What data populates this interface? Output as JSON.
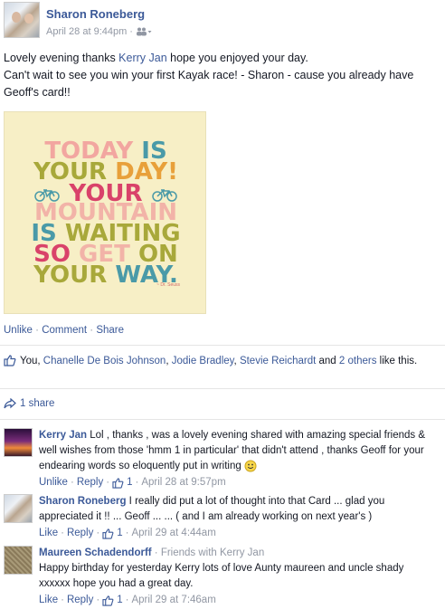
{
  "post": {
    "author": "Sharon Roneberg",
    "timestamp": "April 28 at 9:44pm",
    "text_line1_pre": "Lovely evening thanks ",
    "text_tag": "Kerry Jan",
    "text_line1_post": " hope you enjoyed your day.",
    "text_line2": "Can't wait to see you win your first Kayak race! - Sharon - cause you already have Geoff's card!!",
    "image": {
      "line1a": "TODAY",
      "line1b": "IS",
      "line2a": "YOUR",
      "line2b": "DAY!",
      "line3": "YOUR",
      "line4": "MOUNTAIN",
      "line5a": "IS",
      "line5b": "WAITING",
      "line6a": "SO",
      "line6b": "GET",
      "line6c": "ON",
      "line7a": "YOUR",
      "line7b": "WAY.",
      "signature": "~ Dr. Seuss"
    },
    "actions": {
      "unlike": "Unlike",
      "comment": "Comment",
      "share": "Share"
    },
    "likes": {
      "you": "You, ",
      "person1": "Chanelle De Bois Johnson",
      "comma1": ", ",
      "person2": "Jodie Bradley",
      "comma2": ", ",
      "person3": "Stevie Reichardt",
      "and": " and ",
      "others": "2 others",
      "suffix": " like this."
    },
    "shares": "1 share"
  },
  "comments": [
    {
      "name": "Kerry Jan",
      "text": " Lol , thanks , was a lovely evening shared with amazing special friends & well wishes from those 'hmm 1 in particular' that didn't attend , thanks Geoff for your endearing words so eloquently put in writing ",
      "action": "Unlike",
      "reply": "Reply",
      "likes": "1",
      "time": "April 28 at 9:57pm"
    },
    {
      "name": "Sharon Roneberg",
      "text": " I really did put a lot of thought into that Card ... glad you appreciated it !! ... Geoff ... ... ( and I am already working on next year's )",
      "action": "Like",
      "reply": "Reply",
      "likes": "1",
      "time": "April 29 at 4:44am"
    },
    {
      "name": "Maureen Schadendorff",
      "note": " · Friends with Kerry Jan",
      "text": "Happy birthday for yesterday Kerry lots of love Aunty maureen and uncle shady xxxxxx hope you had a great day.",
      "action": "Like",
      "reply": "Reply",
      "likes": "1",
      "time": "April 29 at 7:46am"
    }
  ],
  "colors": {
    "link": "#3b5998",
    "meta": "#9197a3",
    "text": "#141823"
  }
}
